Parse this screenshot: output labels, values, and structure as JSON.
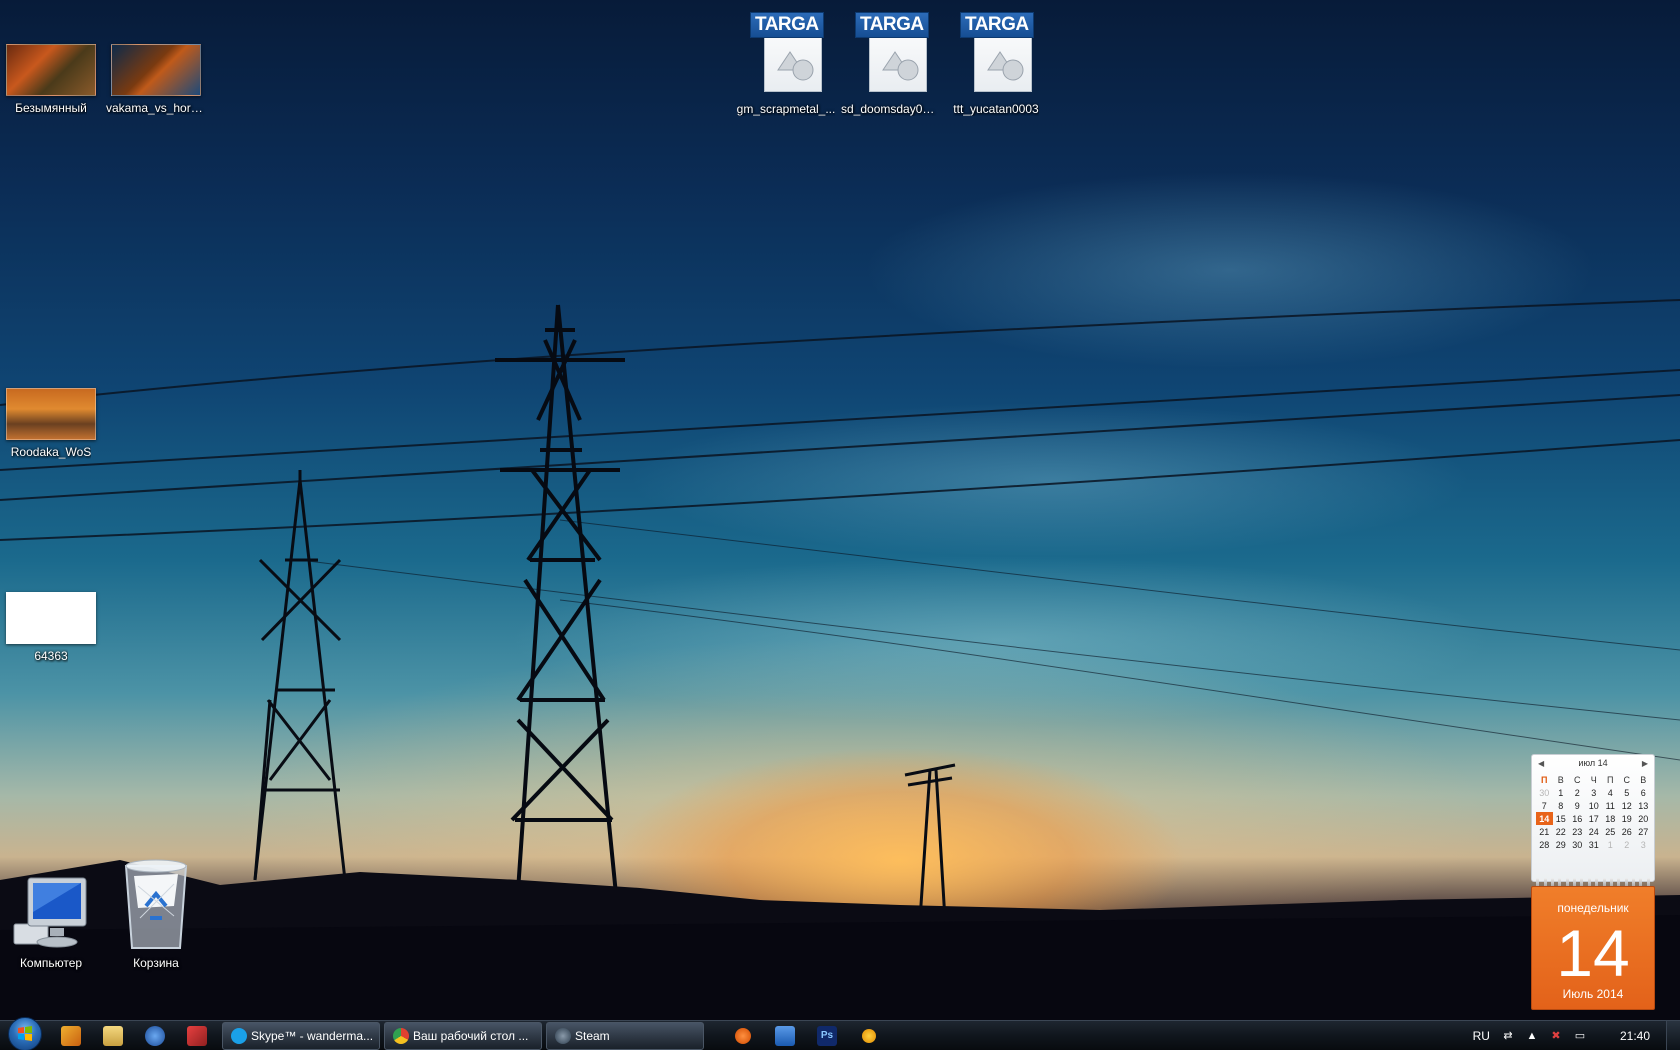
{
  "desktop": {
    "icons": [
      {
        "name": "Безымянный"
      },
      {
        "name": "vakama_vs_hord..."
      },
      {
        "name": "Roodaka_WoS"
      },
      {
        "name": "64363"
      }
    ],
    "targa_files": [
      {
        "badge": "TARGA",
        "name": "gm_scrapmetal_..."
      },
      {
        "badge": "TARGA",
        "name": "sd_doomsday0001"
      },
      {
        "badge": "TARGA",
        "name": "ttt_yucatan0003"
      }
    ],
    "system_icons": {
      "computer": "Компьютер",
      "recycle_bin": "Корзина"
    }
  },
  "calendar_gadget": {
    "month_label": "июл 14",
    "weekday_headers": [
      "П",
      "В",
      "С",
      "Ч",
      "П",
      "С",
      "В"
    ],
    "weeks": [
      [
        "30",
        "1",
        "2",
        "3",
        "4",
        "5",
        "6"
      ],
      [
        "7",
        "8",
        "9",
        "10",
        "11",
        "12",
        "13"
      ],
      [
        "14",
        "15",
        "16",
        "17",
        "18",
        "19",
        "20"
      ],
      [
        "21",
        "22",
        "23",
        "24",
        "25",
        "26",
        "27"
      ],
      [
        "28",
        "29",
        "30",
        "31",
        "1",
        "2",
        "3"
      ]
    ],
    "today": "14",
    "weekday": "понедельник",
    "day": "14",
    "month_year": "Июль 2014",
    "accent_color": "#e8641a"
  },
  "taskbar": {
    "pinned": [
      {
        "icon": "media-player-icon",
        "color": "#e89020"
      },
      {
        "icon": "explorer-folder-icon",
        "color": "#e8c060"
      },
      {
        "icon": "thunderbird-icon",
        "color": "#3a7ad0"
      },
      {
        "icon": "crossover-icon",
        "color": "#c83030"
      }
    ],
    "tasks": [
      {
        "label": "Skype™ - wanderma...",
        "icon": "skype-icon",
        "color": "#1aa0e8"
      },
      {
        "label": "Ваш рабочий стол ...",
        "icon": "chrome-icon",
        "color": "#e04030"
      },
      {
        "label": "Steam",
        "icon": "steam-icon",
        "color": "#2a3a4a"
      }
    ],
    "pinned_after": [
      {
        "icon": "origin-icon",
        "color": "#f06a10"
      },
      {
        "icon": "outlook-icon",
        "color": "#2a7ad0"
      },
      {
        "icon": "photoshop-icon",
        "color": "#1a4aa8"
      },
      {
        "icon": "avast-icon",
        "color": "#f0a010"
      }
    ],
    "tray": {
      "language": "RU",
      "time": "21:40"
    }
  }
}
